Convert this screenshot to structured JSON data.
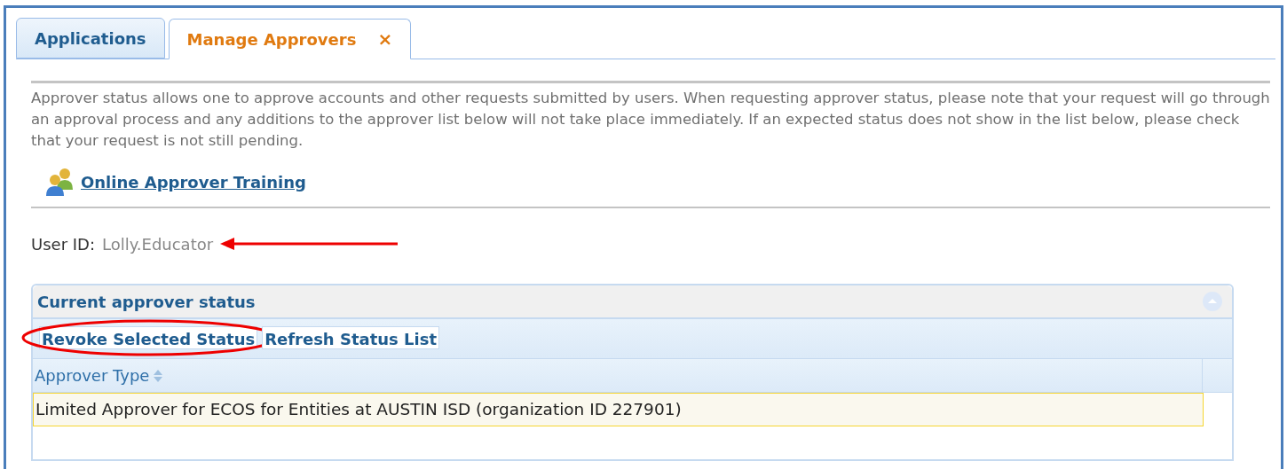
{
  "tabs": [
    {
      "label": "Applications",
      "selected": false,
      "closable": false
    },
    {
      "label": "Manage Approvers",
      "selected": true,
      "closable": true,
      "close_glyph": "×"
    }
  ],
  "intro": "Approver status allows one to approve accounts and other requests submitted by users. When requesting approver status, please note that your request will go through an approval process and any additions to the approver list below will not take place immediately. If an expected status does not show in the list below, please check that your request is not still pending.",
  "training_link": "Online Approver Training",
  "user_id": {
    "label": "User ID:",
    "value": "Lolly.Educator"
  },
  "panel": {
    "title": "Current approver status",
    "collapsed": false,
    "toolbar": [
      {
        "label": "Revoke Selected Status",
        "circled": true
      },
      {
        "label": "Refresh Status List",
        "circled": false
      }
    ],
    "columns": [
      "Approver Type"
    ],
    "rows": [
      {
        "cells": [
          "Limited Approver for ECOS for Entities at AUSTIN ISD (organization ID 227901)"
        ],
        "selected": true
      }
    ]
  }
}
